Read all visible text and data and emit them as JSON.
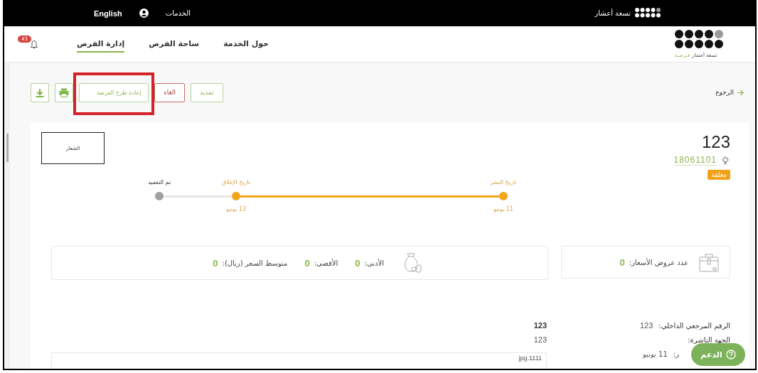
{
  "top_bar": {
    "brand": "تسعة أعشار",
    "services": "الخدمات",
    "language": "English"
  },
  "nav": {
    "logo_name": "تسعة أعشار",
    "logo_tag": "فـرصـة",
    "items": [
      {
        "label": "حول الخدمة",
        "selected": false
      },
      {
        "label": "ساحة الفرص",
        "selected": false
      },
      {
        "label": "إدارة الفرص",
        "selected": true
      }
    ],
    "notifications_badge": "43"
  },
  "toolbar": {
    "back": "الرجوع",
    "buttons": [
      {
        "label": "تمديد",
        "kind": "primary",
        "highlighted": false
      },
      {
        "label": "الغاء",
        "kind": "danger",
        "highlighted": false
      },
      {
        "label": "إعادة طرح الفرصة",
        "kind": "primary",
        "highlighted": true
      }
    ],
    "icon_buttons": [
      {
        "kind": "print"
      },
      {
        "kind": "download"
      }
    ]
  },
  "opportunity": {
    "title": "123",
    "number": "18061101",
    "status": "معلقة",
    "logo_label": "الشعار"
  },
  "timeline": [
    {
      "label": "تاريخ النشر",
      "date": "11 يونيو",
      "reached": true
    },
    {
      "label": "تاريخ الإغلاق",
      "date": "13 يونيو",
      "reached": true
    },
    {
      "label": "تم التعميد",
      "reached": false
    }
  ],
  "stats": {
    "offers": {
      "label": "عدد عروض الأسعار:",
      "value": "0"
    },
    "prices": [
      {
        "label": "الأدنى:",
        "value": "0"
      },
      {
        "label": "الأقصى:",
        "value": "0"
      },
      {
        "label": "متوسط السعر (ريال):",
        "value": "0"
      }
    ]
  },
  "details": {
    "rows": [
      {
        "label": "الرقم المرجعي الداخلي:",
        "value": "123",
        "kind": "full"
      },
      {
        "label": "الجهة الناشرة:",
        "kind": "full"
      },
      {
        "label": "ر:",
        "value": "11 يونيو",
        "kind": "partial"
      }
    ],
    "side": [
      {
        "text": "123",
        "bold": true
      },
      {
        "text": "123",
        "bold": false
      }
    ],
    "attachment": "jpg.1111"
  },
  "support_button": "الدعم"
}
